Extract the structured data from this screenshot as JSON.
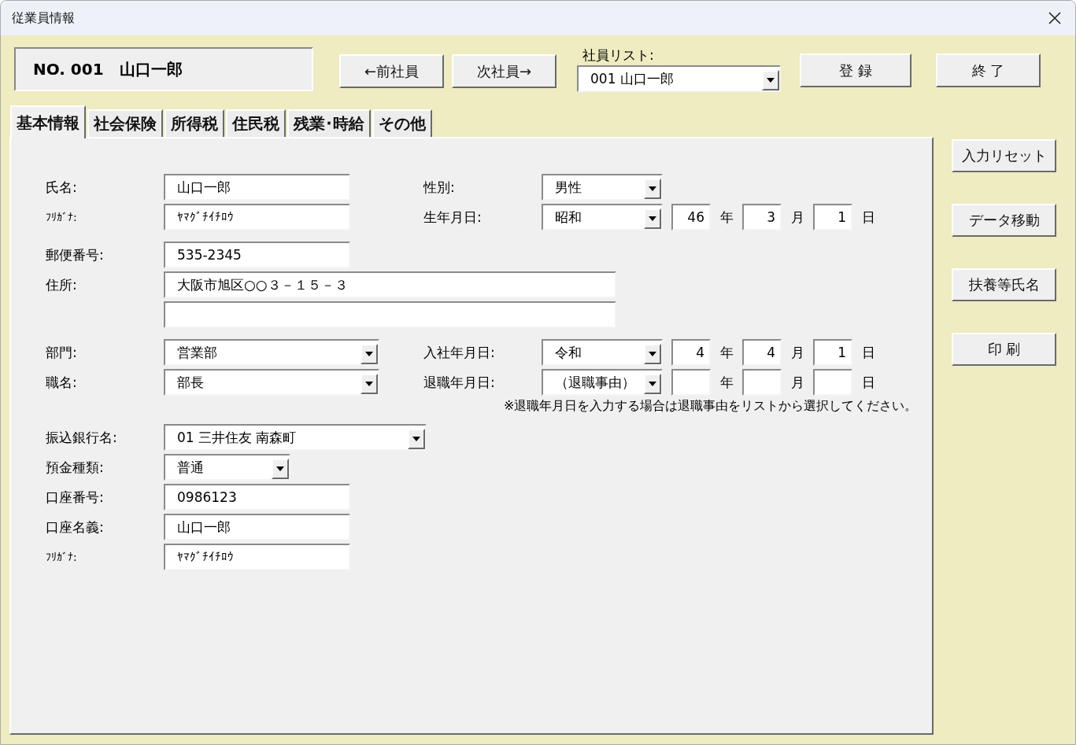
{
  "window": {
    "title": "従業員情報"
  },
  "record_caption": "NO. 001　山口一郎",
  "nav_buttons": [
    "←前社員",
    "次社員→"
  ],
  "employee_list": {
    "label": "社員リスト:",
    "value": "001 山口一郎"
  },
  "action_buttons": [
    "登 録",
    "終 了"
  ],
  "tabs": [
    {
      "label": "基本情報",
      "selected": true
    },
    {
      "label": "社会保険",
      "selected": false
    },
    {
      "label": "所得税",
      "selected": false
    },
    {
      "label": "住民税",
      "selected": false
    },
    {
      "label": "残業･時給",
      "selected": false
    },
    {
      "label": "その他",
      "selected": false
    }
  ],
  "side_buttons": [
    "入力リセット",
    "データ移動",
    "扶養等氏名",
    "印 刷"
  ],
  "name": {
    "label": "氏名:",
    "value": "山口一郎"
  },
  "kana": {
    "label": "ﾌﾘｶﾞﾅ:",
    "value": "ﾔﾏｸﾞﾁｲﾁﾛｳ"
  },
  "gender": {
    "label": "性別:",
    "value": "男性"
  },
  "birth_date": {
    "label": "生年月日:",
    "era": "昭和",
    "year": "46",
    "month": "3",
    "day": "1",
    "units": [
      "年",
      "月",
      "日"
    ]
  },
  "postal_code": {
    "label": "郵便番号:",
    "value": "535-2345"
  },
  "address": {
    "label": "住所:",
    "value": "大阪市旭区○○３－１５－３"
  },
  "department": {
    "label": "部門:",
    "value": "営業部"
  },
  "position": {
    "label": "職名:",
    "value": "部長"
  },
  "hire_date": {
    "label": "入社年月日:",
    "era": "令和",
    "year": "4",
    "month": "4",
    "day": "1",
    "units": [
      "年",
      "月",
      "日"
    ]
  },
  "retire_date": {
    "label": "退職年月日:",
    "era": "（退職事由）",
    "units": [
      "年",
      "月",
      "日"
    ]
  },
  "retire_note": "※退職年月日を入力する場合は退職事由をリストから選択してください。",
  "bank": {
    "label": "振込銀行名:",
    "value": "01 三井住友  南森町"
  },
  "account_type": {
    "label": "預金種類:",
    "value": "普通"
  },
  "account_number": {
    "label": "口座番号:",
    "value": "0986123"
  },
  "account_holder": {
    "label": "口座名義:",
    "value": "山口一郎"
  },
  "holder_kana": {
    "label": "ﾌﾘｶﾞﾅ:",
    "value": "ﾔﾏｸﾞﾁｲﾁﾛｳ"
  }
}
